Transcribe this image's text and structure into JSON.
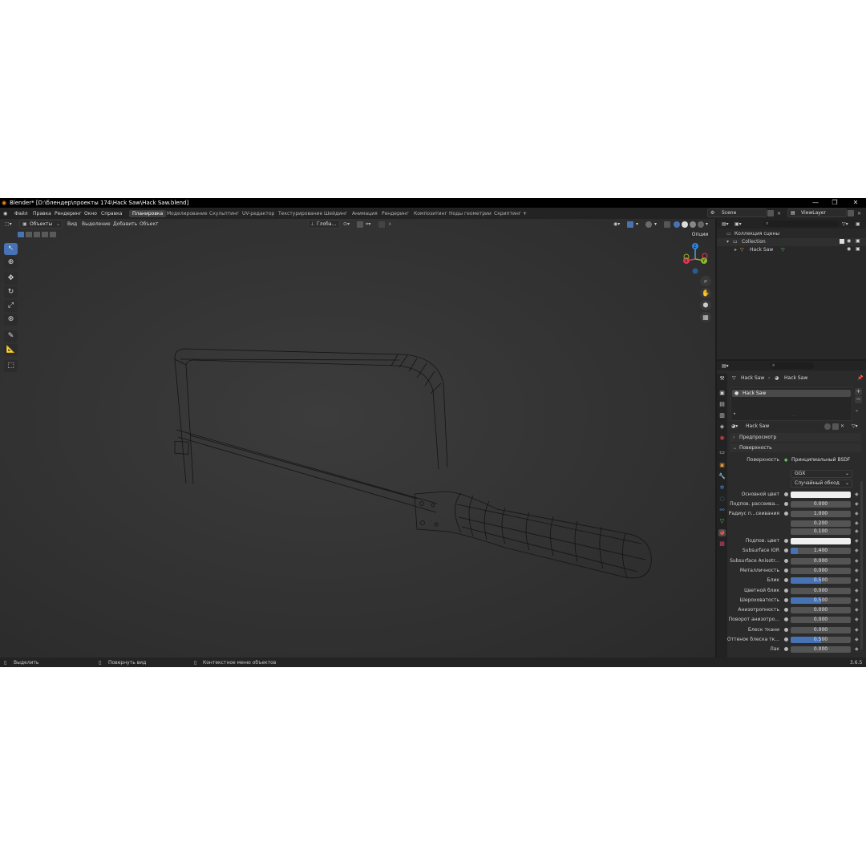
{
  "titlebar": {
    "title": "Blender* [D:\\блендер\\проекты 174\\Hack Saw\\Hack Saw.blend]",
    "minimize": "—",
    "maximize": "❐",
    "close": "✕"
  },
  "menu": {
    "items": [
      "Файл",
      "Правка",
      "Рендеринг",
      "Окно",
      "Справка"
    ],
    "workspaces": [
      "Планировка",
      "Моделирование",
      "Скульптинг",
      "UV-редактор",
      "Текстурирование",
      "Шейдинг",
      "Анимация",
      "Рендеринг",
      "Композитинг",
      "Ноды геометрии",
      "Скриптинг"
    ],
    "active_workspace": "Планировка",
    "add_workspace": "+",
    "scene": "Scene",
    "view_layer": "ViewLayer"
  },
  "viewport_header": {
    "mode": "Объекты",
    "menus": [
      "Вид",
      "Выделение",
      "Добавить",
      "Объект"
    ],
    "transform_orientation": "Глоба...",
    "options": "Опции"
  },
  "gizmo": {
    "x": "X",
    "y": "Y",
    "z": "Z"
  },
  "statusbar": {
    "select": "Выделить",
    "rotate_view": "Повернуть вид",
    "context_menu": "Контекстное меню объектов",
    "version": "3.6.5"
  },
  "outliner": {
    "scene_collection": "Коллекция сцены",
    "collection": "Collection",
    "object": "Hack Saw"
  },
  "properties": {
    "breadcrumb_object": "Hack Saw",
    "breadcrumb_material": "Hack Saw",
    "material_slot": "Hack Saw",
    "material_name": "Hack Saw",
    "sections": {
      "preview": "Предпросмотр",
      "surface": "Поверхность"
    },
    "surface_label": "Поверхность",
    "surface_value": "Принципиальный BSDF",
    "distribution": "GGX",
    "subsurface_method": "Случайный обход",
    "rows": [
      {
        "label": "Основной цвет",
        "value": "",
        "kind": "color"
      },
      {
        "label": "Подпов. рассеива...",
        "value": "0.000",
        "kind": "num",
        "fill": 0
      },
      {
        "label": "Радиус п...сеивания",
        "value": "1.000",
        "kind": "num",
        "fill": 0
      },
      {
        "label": "",
        "value": "0.200",
        "kind": "num",
        "fill": 0
      },
      {
        "label": "",
        "value": "0.100",
        "kind": "num",
        "fill": 0
      },
      {
        "label": "Подпов. цвет",
        "value": "",
        "kind": "color"
      },
      {
        "label": "Subsurface IOR",
        "value": "1.400",
        "kind": "num",
        "fill": 0.12
      },
      {
        "label": "Subsurface Anisotr...",
        "value": "0.000",
        "kind": "num",
        "fill": 0
      },
      {
        "label": "Металличность",
        "value": "0.000",
        "kind": "num",
        "fill": 0
      },
      {
        "label": "Блик",
        "value": "0.500",
        "kind": "num",
        "fill": 0.5
      },
      {
        "label": "Цветной блик",
        "value": "0.000",
        "kind": "num",
        "fill": 0
      },
      {
        "label": "Шероховатость",
        "value": "0.500",
        "kind": "num",
        "fill": 0.5
      },
      {
        "label": "Анизотропность",
        "value": "0.000",
        "kind": "num",
        "fill": 0
      },
      {
        "label": "Поворот анизотро...",
        "value": "0.000",
        "kind": "num",
        "fill": 0
      },
      {
        "label": "Блеск ткани",
        "value": "0.000",
        "kind": "num",
        "fill": 0
      },
      {
        "label": "Оттенок блеска тк...",
        "value": "0.500",
        "kind": "num",
        "fill": 0.5
      },
      {
        "label": "Лак",
        "value": "0.000",
        "kind": "num",
        "fill": 0
      }
    ]
  },
  "colors": {
    "accent": "#4772b3",
    "header": "#232323",
    "panel": "#2b2b2b"
  }
}
